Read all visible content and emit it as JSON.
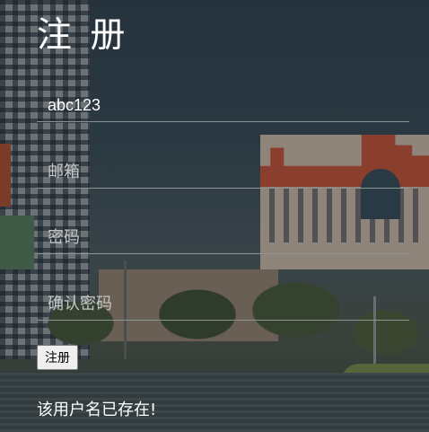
{
  "form": {
    "title": "注 册",
    "username": {
      "value": "abc123"
    },
    "email": {
      "placeholder": "邮箱"
    },
    "password": {
      "placeholder": "密码"
    },
    "confirm_password": {
      "placeholder": "确认密码"
    },
    "submit_label": "注册",
    "error_message": "该用户名已存在!"
  },
  "colors": {
    "text": "#ffffff",
    "field_underline": "#8c9494",
    "placeholder": "#c4c6c4"
  }
}
